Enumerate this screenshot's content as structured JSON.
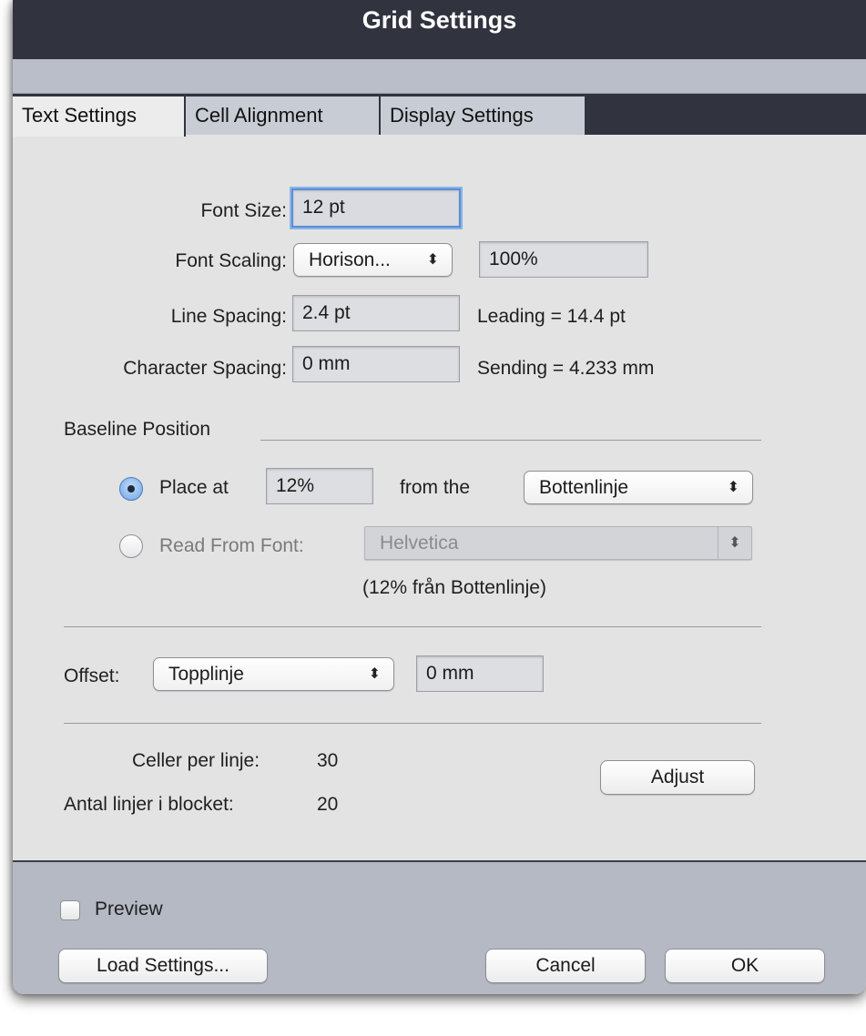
{
  "window": {
    "title": "Grid Settings"
  },
  "tabs": [
    {
      "label": "Text Settings",
      "active": true
    },
    {
      "label": "Cell Alignment",
      "active": false
    },
    {
      "label": "Display Settings",
      "active": false
    }
  ],
  "text_settings": {
    "font_size": {
      "label": "Font Size:",
      "value": "12 pt"
    },
    "font_scaling": {
      "label": "Font Scaling:",
      "mode": "Horison...",
      "value": "100%"
    },
    "line_spacing": {
      "label": "Line Spacing:",
      "value": "2.4 pt",
      "result": "Leading  =  14.4 pt"
    },
    "character_spacing": {
      "label": "Character Spacing:",
      "value": "0 mm",
      "result": "Sending  =  4.233 mm"
    }
  },
  "baseline": {
    "heading": "Baseline Position",
    "place_at": {
      "label": "Place at",
      "value": "12%",
      "from_label": "from the",
      "reference": "Bottenlinje",
      "selected": true
    },
    "read_from_font": {
      "label": "Read From Font:",
      "font": "Helvetica",
      "selected": false
    },
    "note": "(12% från Bottenlinje)"
  },
  "offset": {
    "label": "Offset:",
    "reference": "Topplinje",
    "value": "0 mm"
  },
  "summary": {
    "cells_per_line": {
      "label": "Celler per linje:",
      "value": "30"
    },
    "lines_in_block": {
      "label": "Antal linjer i blocket:",
      "value": "20"
    },
    "adjust_label": "Adjust"
  },
  "footer": {
    "preview_label": "Preview",
    "preview_checked": false,
    "load_label": "Load Settings...",
    "cancel_label": "Cancel",
    "ok_label": "OK"
  },
  "icons": {
    "popup_arrows": "⬍",
    "stepper_arrows": "⇕"
  },
  "colors": {
    "titlebar": "#31333f",
    "focus_ring": "#5b8fd6",
    "panel": "#e3e3e3",
    "footer": "#b4b9c3"
  }
}
